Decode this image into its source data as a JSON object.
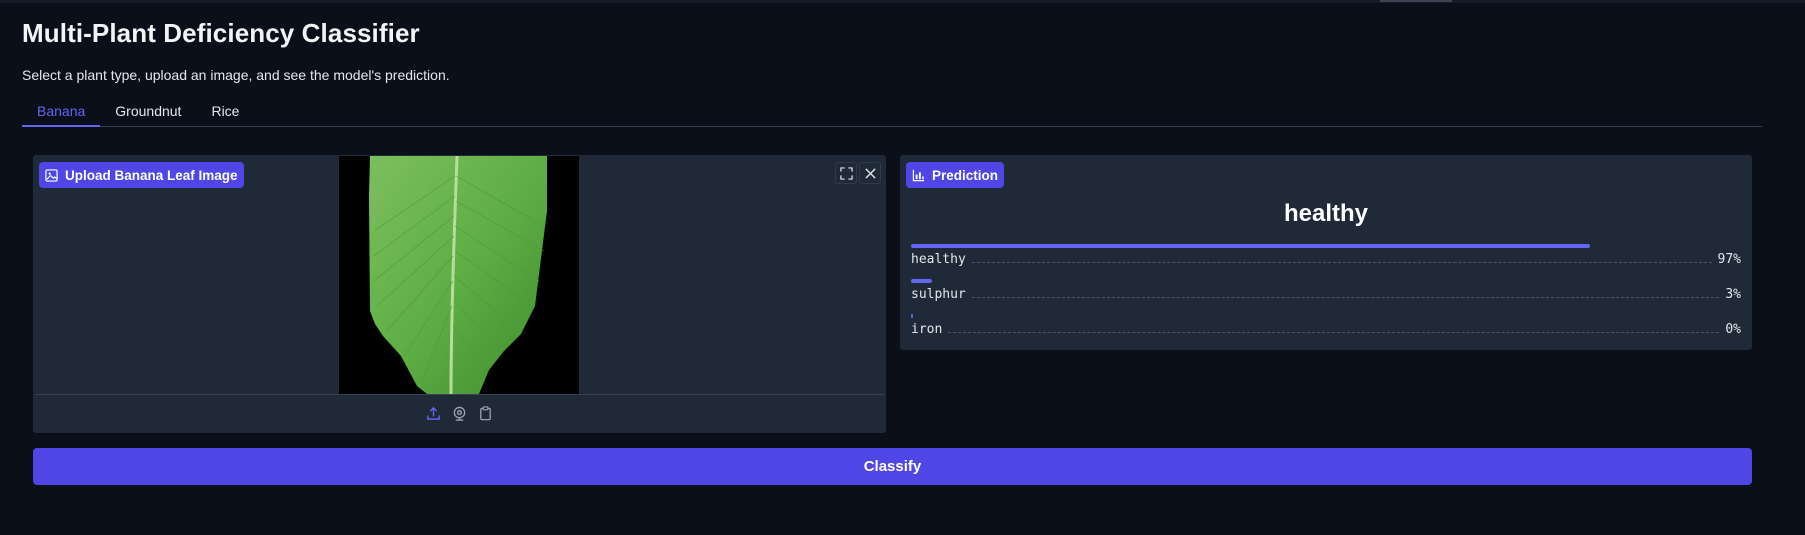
{
  "header": {
    "title": "Multi-Plant Deficiency Classifier",
    "subtitle": "Select a plant type, upload an image, and see the model's prediction."
  },
  "tabs": [
    {
      "label": "Banana",
      "active": true
    },
    {
      "label": "Groundnut",
      "active": false
    },
    {
      "label": "Rice",
      "active": false
    }
  ],
  "upload": {
    "label": "Upload Banana Leaf Image",
    "label_icon": "image-icon",
    "controls": [
      "fullscreen-icon",
      "close-icon"
    ],
    "sources": [
      "upload-icon",
      "webcam-icon",
      "clipboard-icon"
    ]
  },
  "prediction": {
    "label": "Prediction",
    "label_icon": "bar-chart-icon",
    "top_class": "healthy",
    "confidences": [
      {
        "name": "healthy",
        "percent": "97%",
        "value": 0.97
      },
      {
        "name": "sulphur",
        "percent": "3%",
        "value": 0.03
      },
      {
        "name": "iron",
        "percent": "0%",
        "value": 0.003
      }
    ]
  },
  "actions": {
    "classify_label": "Classify"
  },
  "colors": {
    "background": "#0b0f19",
    "panel": "#1f2937",
    "accent": "#4f46e5",
    "bar": "#6366f1"
  }
}
